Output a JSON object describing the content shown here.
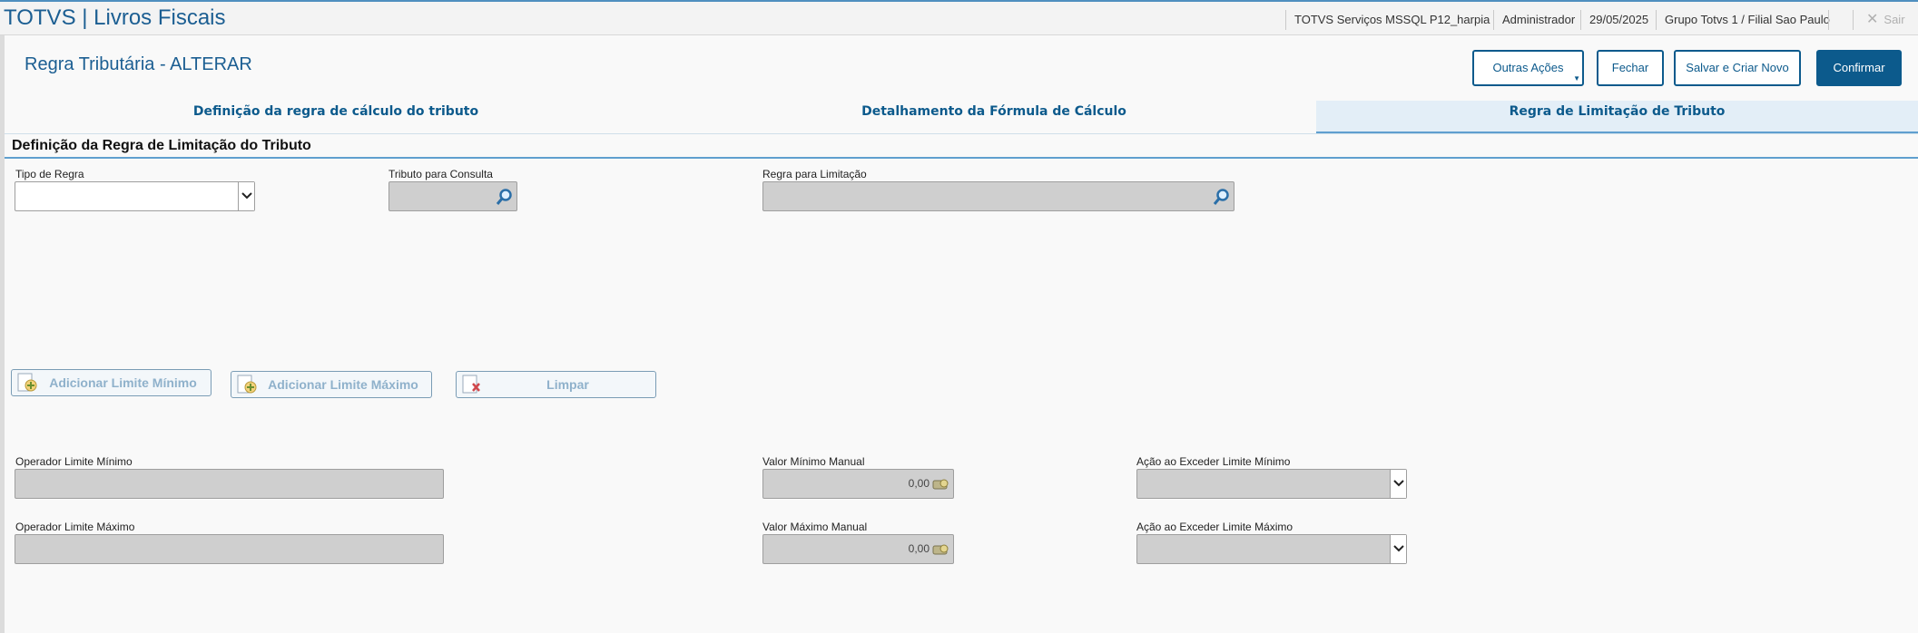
{
  "header": {
    "app_title": "TOTVS | Livros Fiscais",
    "environment": "TOTVS Serviços MSSQL P12_harpia",
    "user": "Administrador",
    "date": "29/05/2025",
    "company": "Grupo Totvs 1 / Filial Sao Paulo",
    "exit_label": "Sair"
  },
  "page": {
    "title": "Regra Tributária - ALTERAR"
  },
  "actions": {
    "other": "Outras Ações",
    "close": "Fechar",
    "save_new": "Salvar e Criar Novo",
    "confirm": "Confirmar"
  },
  "tabs": [
    {
      "label": "Definição da regra de cálculo do tributo",
      "active": false
    },
    {
      "label": "Detalhamento da Fórmula de Cálculo",
      "active": false
    },
    {
      "label": "Regra de Limitação de Tributo",
      "active": true
    }
  ],
  "section": {
    "title": "Definição da Regra de Limitação do Tributo"
  },
  "fields": {
    "tipo_regra": {
      "label": "Tipo de Regra",
      "value": ""
    },
    "tributo_consulta": {
      "label": "Tributo para Consulta",
      "value": ""
    },
    "regra_limitacao": {
      "label": "Regra para Limitação",
      "value": ""
    },
    "operador_min": {
      "label": "Operador Limite Mínimo",
      "value": ""
    },
    "valor_min": {
      "label": "Valor Mínimo Manual",
      "value": "0,00"
    },
    "acao_min": {
      "label": "Ação ao Exceder Limite Mínimo",
      "value": ""
    },
    "operador_max": {
      "label": "Operador Limite Máximo",
      "value": ""
    },
    "valor_max": {
      "label": "Valor Máximo Manual",
      "value": "0,00"
    },
    "acao_max": {
      "label": "Ação ao Exceder Limite Máximo",
      "value": ""
    }
  },
  "limit_buttons": {
    "add_min": "Adicionar Limite Mínimo",
    "add_max": "Adicionar Limite Máximo",
    "clear": "Limpar"
  },
  "colors": {
    "brand": "#0c5a8c",
    "title": "#1b5e92",
    "accent_line": "#5f9fcf",
    "disabled_field": "#cfcfcf"
  }
}
